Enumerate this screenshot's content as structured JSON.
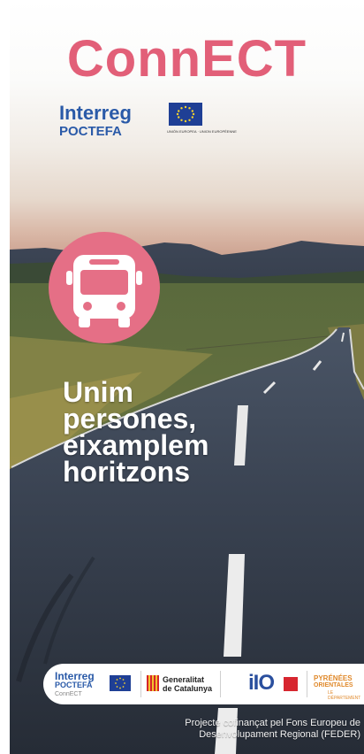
{
  "poster": {
    "title": "ConnECT",
    "program": {
      "name": "Interreg",
      "sub": "POCTEFA",
      "eu_caption": "UNIÓN EUROPEA · UNION EUROPÉENNE"
    },
    "icon": "bus-icon",
    "slogan_lines": [
      "Unim",
      "persones,",
      "eixamplem",
      "horitzons"
    ]
  },
  "partners": {
    "interreg": "Interreg",
    "poctefa": "POCTEFA",
    "project": "ConnECT",
    "generalitat_line1": "Generalitat",
    "generalitat_line2": "de Catalunya",
    "iio": "iIO",
    "pyrenees_line1": "PYRÉNÉES",
    "pyrenees_line2": "ORIENTALES",
    "pyrenees_line3": "LE DÉPARTEMENT"
  },
  "footer": {
    "line1": "Projecte cofinançat pel Fons Europeu de",
    "line2": "Desenvolupament Regional (FEDER)"
  },
  "colors": {
    "brand_pink": "#e25f78",
    "bus_circle": "#e56f86",
    "interreg_blue": "#2a5aa8"
  }
}
